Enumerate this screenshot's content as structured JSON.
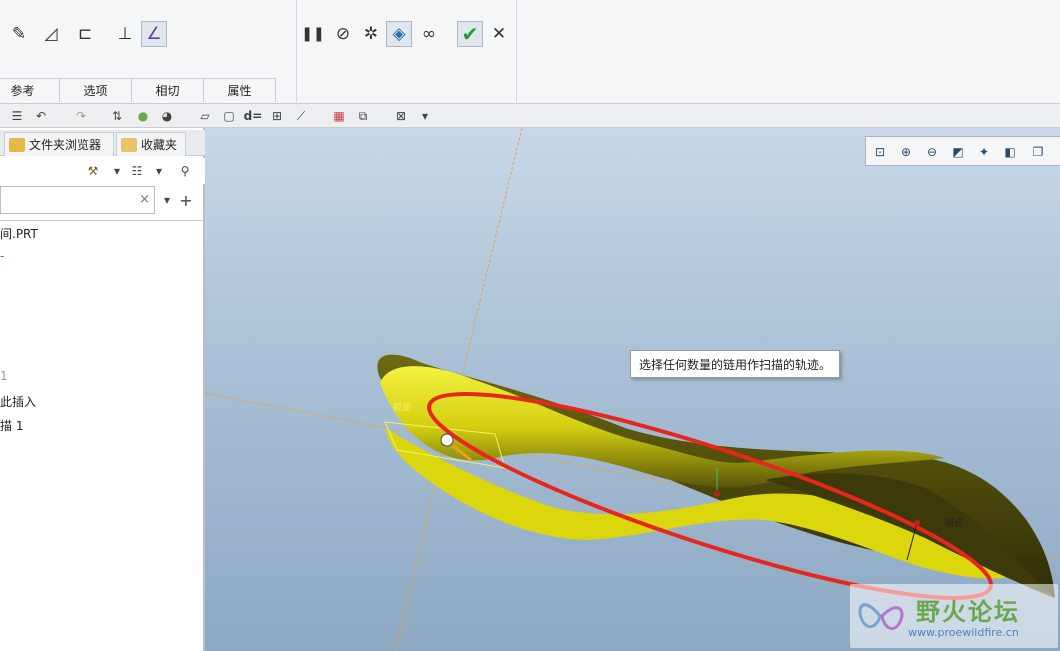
{
  "ribbon": {
    "tabs": [
      "参考",
      "选项",
      "相切",
      "属性"
    ],
    "tool_icons": [
      "sketch-icon",
      "surface-icon",
      "open-section-icon",
      "constant-section-icon",
      "variable-section-icon"
    ],
    "action_icons": [
      "pause-icon",
      "no-preview-icon",
      "verify-icon",
      "preview-icon",
      "glasses-icon",
      "confirm-check-icon",
      "cancel-x-icon"
    ]
  },
  "left_panel": {
    "tabs": [
      "文件夹浏览器",
      "收藏夹"
    ],
    "search": {
      "clear": "×",
      "add": "+"
    },
    "tree": [
      "间.PRT",
      "",
      "1",
      "此插入",
      "描 1"
    ]
  },
  "viewport": {
    "tooltip": "选择任何数量的链用作扫描的轨迹。",
    "labels": {
      "section": "截面",
      "origin": "原点"
    },
    "watermark": {
      "title": "野火论坛",
      "url": "www.proewildfire.cn"
    }
  },
  "colors": {
    "model_yellow": "#e6e10a",
    "highlight_red": "#e8261e",
    "background_top": "#c8d8e8",
    "datum_orange": "#e8a040"
  }
}
